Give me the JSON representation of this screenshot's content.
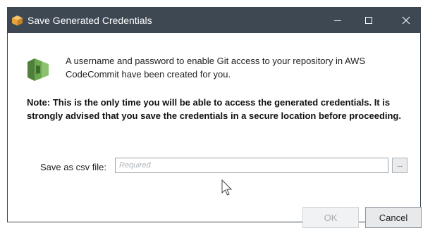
{
  "window": {
    "title": "Save Generated Credentials",
    "controls": {
      "minimize": "minimize",
      "maximize": "maximize",
      "close": "close"
    }
  },
  "message": {
    "info": "A username and password to enable Git access to your repository in AWS CodeCommit have been created for you.",
    "note": "Note: This is the only time you will be able to access the generated credentials. It is strongly advised that you save the credentials in a secure location before proceeding."
  },
  "form": {
    "csv_label": "Save as csv file:",
    "csv_value": "",
    "csv_placeholder": "Required",
    "browse_label": "..."
  },
  "buttons": {
    "ok_label": "OK",
    "cancel_label": "Cancel"
  },
  "colors": {
    "titlebar": "#3d4853",
    "codecommit_green": "#6aa84f",
    "app_icon_orange": "#e8a33d"
  }
}
